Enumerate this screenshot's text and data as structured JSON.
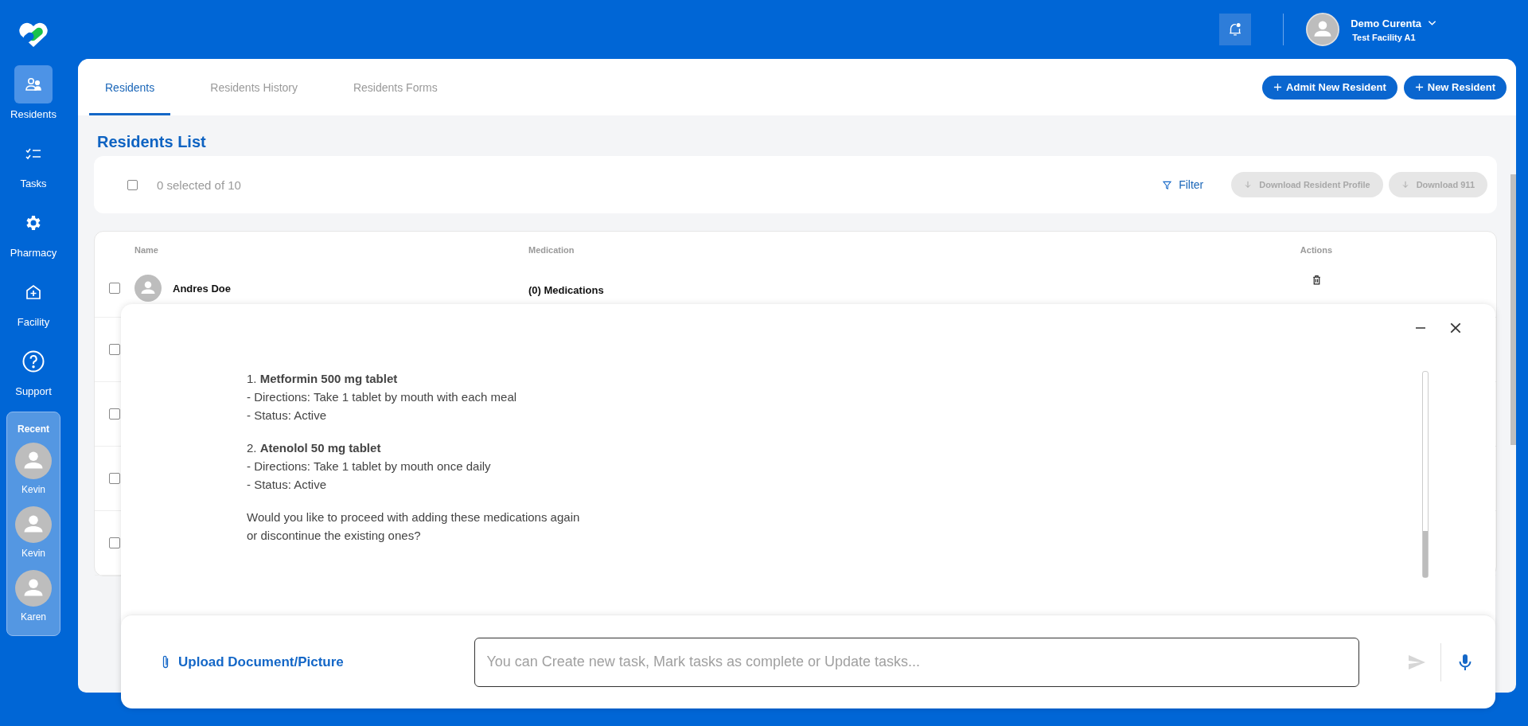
{
  "header": {
    "user_name": "Demo Curenta",
    "facility": "Test Facility A1"
  },
  "sidebar": {
    "items": [
      {
        "label": "Residents",
        "kind": "residents",
        "selected": true
      },
      {
        "label": "Tasks",
        "kind": "tasks",
        "selected": false
      },
      {
        "label": "Pharmacy",
        "kind": "pharmacy",
        "selected": false
      },
      {
        "label": "Facility",
        "kind": "facility",
        "selected": false
      },
      {
        "label": "Support",
        "kind": "support",
        "selected": false
      }
    ],
    "recent": {
      "title": "Recent",
      "people": [
        {
          "name": "Kevin"
        },
        {
          "name": "Kevin"
        },
        {
          "name": "Karen"
        }
      ]
    }
  },
  "tabs": [
    {
      "label": "Residents",
      "selected": true
    },
    {
      "label": "Residents History",
      "selected": false
    },
    {
      "label": "Residents Forms",
      "selected": false
    }
  ],
  "actions": [
    "Admit New Resident",
    "New Resident"
  ],
  "list": {
    "title": "Residents List",
    "select_all_checked": false,
    "selection_text": "0 selected of 10",
    "filter": "Filter",
    "downloads": [
      {
        "label": "Download Resident Profile",
        "disabled": true
      },
      {
        "label": "Download 911",
        "disabled": true
      }
    ]
  },
  "table": {
    "columns": [
      "Name",
      "Medication",
      "Actions"
    ],
    "rows": [
      {
        "checked": false,
        "name": "Andres Doe",
        "medication": "(0) Medications"
      },
      {
        "checked": false
      },
      {
        "checked": false
      },
      {
        "checked": false
      },
      {
        "checked": false
      }
    ]
  },
  "chat": {
    "paragraphs": [
      [
        "1. **Metformin 500 mg tablet**",
        "- Directions: Take 1 tablet by mouth with each meal",
        "- Status: Active"
      ],
      [
        "2. **Atenolol 50 mg tablet**",
        "- Directions: Take 1 tablet by mouth once daily",
        "- Status: Active"
      ],
      [
        "Would you like to proceed with adding these medications again",
        "or discontinue the existing ones?"
      ]
    ],
    "upload": "Upload Document/Picture",
    "placeholder": "You can Create new task, Mark tasks as complete or Update tasks..."
  }
}
